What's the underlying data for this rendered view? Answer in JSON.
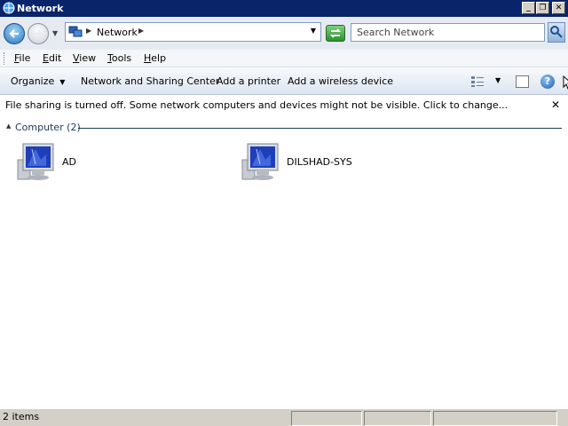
{
  "window": {
    "title": "Network"
  },
  "address": {
    "breadcrumb": "Network",
    "search_placeholder": "Search Network"
  },
  "menu": {
    "items": [
      {
        "key": "F",
        "rest": "ile"
      },
      {
        "key": "E",
        "rest": "dit"
      },
      {
        "key": "V",
        "rest": "iew"
      },
      {
        "key": "T",
        "rest": "ools"
      },
      {
        "key": "H",
        "rest": "elp"
      }
    ]
  },
  "commands": {
    "organize": "Organize",
    "network_center": "Network and Sharing Center",
    "add_printer": "Add a printer",
    "add_wireless": "Add a wireless device"
  },
  "infobar": {
    "message": "File sharing is turned off. Some network computers and devices might not be visible. Click to change..."
  },
  "group": {
    "title": "Computer (2)"
  },
  "computers": [
    {
      "name": "AD"
    },
    {
      "name": "DILSHAD-SYS"
    }
  ],
  "status": {
    "items_count": "2 items"
  },
  "colors": {
    "titlebar": "#0a246a",
    "group_line": "#1e395b"
  }
}
